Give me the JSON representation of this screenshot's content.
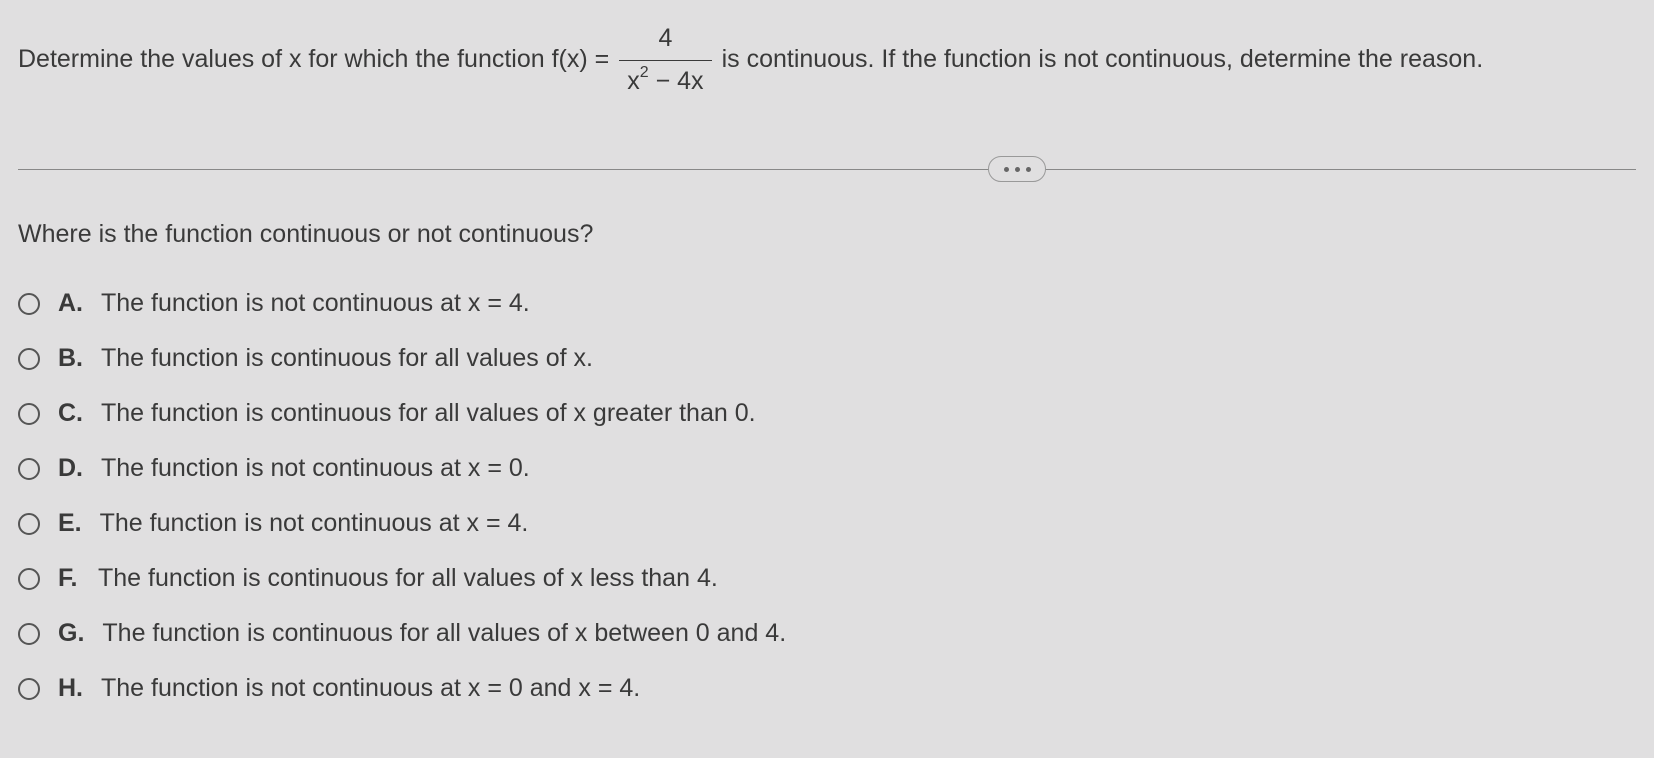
{
  "question": {
    "prefix": "Determine the values of x for which the function f(x) =",
    "fraction_num": "4",
    "fraction_den_base": "x",
    "fraction_den_exp": "2",
    "fraction_den_rest": " − 4x",
    "suffix": " is continuous. If the function is not continuous, determine the reason."
  },
  "subquestion": "Where is the function continuous or not continuous?",
  "options": [
    {
      "letter": "A.",
      "text": "The function is not continuous at x = 4."
    },
    {
      "letter": "B.",
      "text": "The function is continuous for all values of x."
    },
    {
      "letter": "C.",
      "text": "The function is continuous for all values of x greater than 0."
    },
    {
      "letter": "D.",
      "text": "The function is not continuous at x = 0."
    },
    {
      "letter": "E.",
      "text": "The function is not continuous at x = 4."
    },
    {
      "letter": "F.",
      "text": "The function is continuous for all values of x less than 4."
    },
    {
      "letter": "G.",
      "text": "The function is continuous for all values of x between 0 and 4."
    },
    {
      "letter": "H.",
      "text": "The function is not continuous at x = 0 and x = 4."
    }
  ]
}
